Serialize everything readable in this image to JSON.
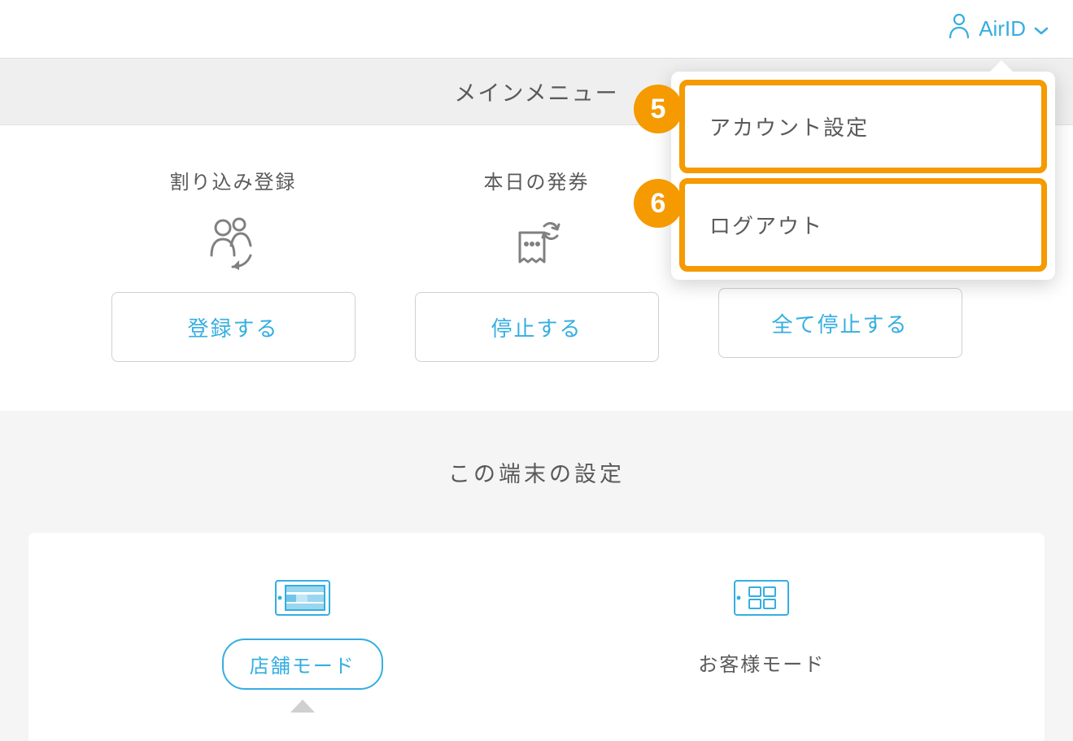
{
  "header": {
    "user_label": "AirID"
  },
  "main_menu": {
    "title": "メインメニュー",
    "cards": [
      {
        "title": "割り込み登録",
        "button": "登録する"
      },
      {
        "title": "本日の発券",
        "button": "停止する"
      },
      {
        "title": "",
        "button": "全て停止する"
      }
    ]
  },
  "settings": {
    "title": "この端末の設定",
    "modes": [
      {
        "label": "店舗モード",
        "selected": true
      },
      {
        "label": "お客様モード",
        "selected": false
      }
    ]
  },
  "dropdown": {
    "items": [
      {
        "label": "アカウント設定"
      },
      {
        "label": "ログアウト"
      }
    ]
  },
  "callouts": {
    "badge5": "5",
    "badge6": "6"
  },
  "colors": {
    "accent": "#35aee1",
    "highlight": "#f59a00"
  }
}
